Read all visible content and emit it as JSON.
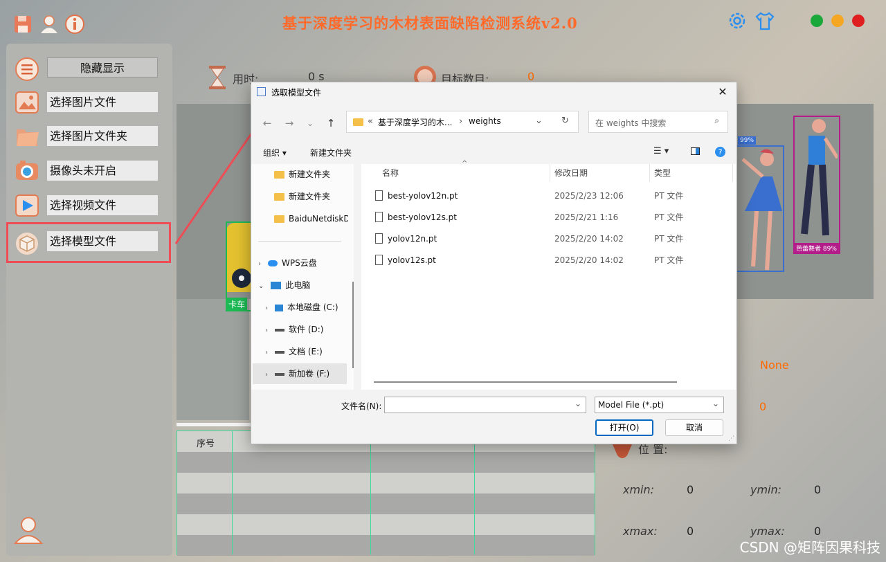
{
  "app": {
    "title": "基于深度学习的木材表面缺陷检测系统v2.0",
    "colors": {
      "accent": "#ff6a2a",
      "win_green": "#1aa83a",
      "win_yellow": "#f5a623",
      "win_red": "#e02020",
      "highlight": "#ee4d55",
      "table_line": "#3fd99a"
    }
  },
  "sidebar": {
    "toggle_label": "隐藏显示",
    "items": [
      {
        "label": "选择图片文件",
        "icon": "image-icon"
      },
      {
        "label": "选择图片文件夹",
        "icon": "folder-icon"
      },
      {
        "label": "摄像头未开启",
        "icon": "camera-icon"
      },
      {
        "label": "选择视频文件",
        "icon": "video-icon"
      },
      {
        "label": "选择模型文件",
        "icon": "model-cube-icon"
      }
    ]
  },
  "stats": {
    "time_label": "用时:",
    "time_value": "0 s",
    "target_label": "目标数目:",
    "target_value": "0"
  },
  "detections": {
    "truck_label": "卡车",
    "dancer1_label": "99%",
    "dancer2_label": "芭蕾舞者 89%"
  },
  "info": {
    "type_value": "None",
    "conf_value": "0",
    "position_label": "位  置:",
    "xmin_label": "xmin:",
    "xmin_value": "0",
    "ymin_label": "ymin:",
    "ymin_value": "0",
    "xmax_label": "xmax:",
    "xmax_value": "0",
    "ymax_label": "ymax:",
    "ymax_value": "0"
  },
  "table": {
    "first_header": "序号"
  },
  "watermark": "CSDN @矩阵因果科技",
  "dialog": {
    "title": "选取模型文件",
    "address": {
      "prefix": "«",
      "path1": "基于深度学习的木...",
      "sep": "›",
      "path2": "weights"
    },
    "search_placeholder": "在 weights 中搜索",
    "organize": "组织 ▾",
    "new_folder": "新建文件夹",
    "nav": [
      {
        "label": "新建文件夹",
        "kind": "folder"
      },
      {
        "label": "新建文件夹",
        "kind": "folder"
      },
      {
        "label": "BaiduNetdiskD",
        "kind": "folder"
      },
      {
        "label": "WPS云盘",
        "kind": "cloud"
      },
      {
        "label": "此电脑",
        "kind": "pc"
      },
      {
        "label": "本地磁盘 (C:)",
        "kind": "drive"
      },
      {
        "label": "软件 (D:)",
        "kind": "drive"
      },
      {
        "label": "文档 (E:)",
        "kind": "drive"
      },
      {
        "label": "新加卷 (F:)",
        "kind": "drive"
      }
    ],
    "columns": {
      "name": "名称",
      "date": "修改日期",
      "type": "类型"
    },
    "files": [
      {
        "name": "best-yolov12n.pt",
        "date": "2025/2/23 12:06",
        "type": "PT 文件"
      },
      {
        "name": "best-yolov12s.pt",
        "date": "2025/2/21 1:16",
        "type": "PT 文件"
      },
      {
        "name": "yolov12n.pt",
        "date": "2025/2/20 14:02",
        "type": "PT 文件"
      },
      {
        "name": "yolov12s.pt",
        "date": "2025/2/20 14:02",
        "type": "PT 文件"
      }
    ],
    "filename_label": "文件名(N):",
    "filename_value": "",
    "filter_value": "Model File (*.pt)",
    "open_label": "打开(O)",
    "cancel_label": "取消"
  }
}
